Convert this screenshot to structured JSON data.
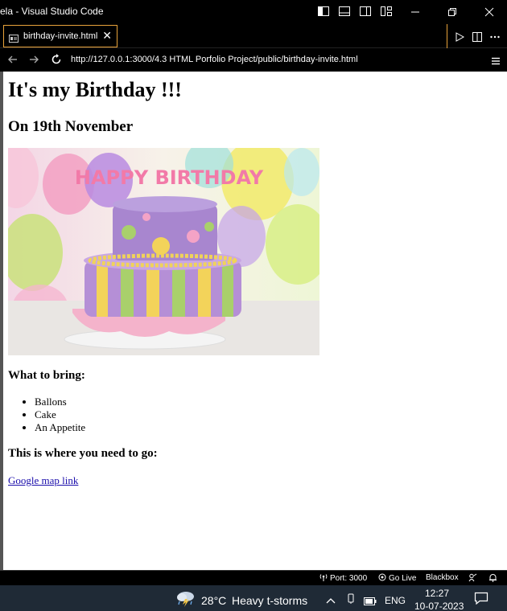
{
  "window": {
    "title": "ela - Visual Studio Code"
  },
  "tab": {
    "label": "birthday-invite.html",
    "close": "✕"
  },
  "browser": {
    "url": "http://127.0.0.1:3000/4.3 HTML Porfolio Project/public/birthday-invite.html"
  },
  "page": {
    "heading": "It's my Birthday !!!",
    "date": "On 19th November",
    "bring_heading": "What to bring:",
    "bring_items": [
      "Ballons",
      "Cake",
      "An Appetite"
    ],
    "go_heading": "This is where you need to go:",
    "map_link": "Google map link",
    "cake_banner": "HAPPY BIRTHDAY"
  },
  "statusbar": {
    "port": "Port: 3000",
    "golive": "Go Live",
    "blackbox": "Blackbox"
  },
  "taskbar": {
    "temperature": "28°C",
    "weather": "Heavy t-storms",
    "language": "ENG",
    "time": "12:27",
    "date": "10-07-2023"
  }
}
